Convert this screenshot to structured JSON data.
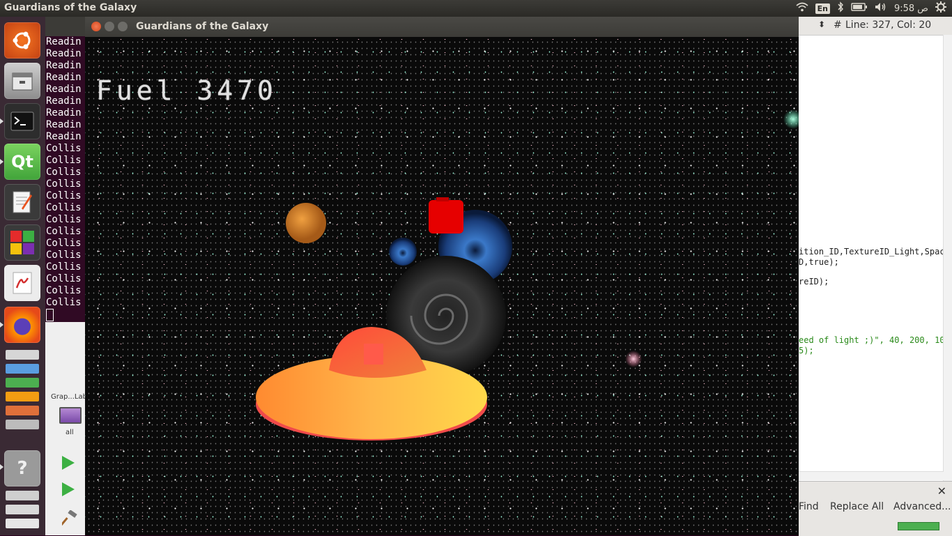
{
  "topbar": {
    "title": "Guardians of the Galaxy",
    "keyboard": "En",
    "clock": "9:58 ص"
  },
  "terminal": {
    "lines": [
      "Readin",
      "Readin",
      "Readin",
      "Readin",
      "Readin",
      "Readin",
      "Readin",
      "Readin",
      "Readin",
      "Collis",
      "Collis",
      "Collis",
      "Collis",
      "Collis",
      "Collis",
      "Collis",
      "Collis",
      "Collis",
      "Collis",
      "Collis",
      "Collis",
      "Collis",
      "Collis"
    ]
  },
  "file_manager": {
    "label": "Grap...Lab",
    "item": "all"
  },
  "game_window": {
    "title": "Guardians of the Galaxy",
    "fuel_text": "Fuel 3470"
  },
  "editor": {
    "status": "Line: 327, Col: 20",
    "hash": "#",
    "code_lines": [
      "ition_ID,TextureID_Light,Spac",
      "D,true);",
      "reID);",
      "eed of light ;)\", 40, 200, 10",
      "5);"
    ],
    "find_label": "Find",
    "replace_all": "Replace All",
    "advanced": "Advanced..."
  },
  "colors": {
    "accent": "#e95420",
    "ufo_top": "#ff4a3a",
    "ufo_body": "#ffb830",
    "fuel_canister": "#e60000"
  }
}
